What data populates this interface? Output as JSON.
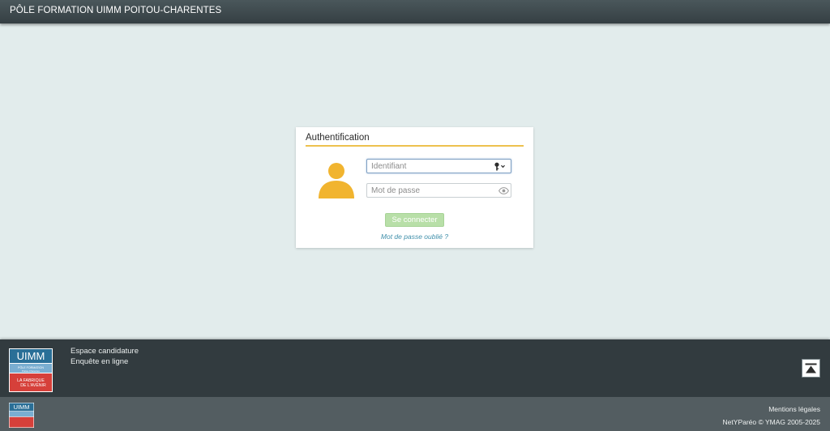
{
  "header": {
    "title": "PÔLE FORMATION UIMM POITOU-CHARENTES"
  },
  "login": {
    "title": "Authentification",
    "avatar_icon": "user-silhouette-icon",
    "identifier_placeholder": "Identifiant",
    "identifier_icon": "key-dropdown-icon",
    "password_placeholder": "Mot de passe",
    "password_icon": "eye-icon",
    "submit_label": "Se connecter",
    "forgot_label": "Mot de passe oublié ?"
  },
  "footer": {
    "logo": {
      "brand": "UIMM",
      "line1": "PÔLE FORMATION",
      "line2": "Poitou-Charentes",
      "tagline1": "LA FABRIQUE",
      "tagline2": "DE L'AVENIR"
    },
    "links": [
      "Espace candidature",
      "Enquête en ligne"
    ],
    "legal_label": "Mentions légales",
    "copyright": "NetYParéo © YMAG 2005-2025"
  },
  "colors": {
    "header_bg": "#3f4a4e",
    "page_bg": "#e2ecec",
    "accent_underline": "#edc14e",
    "avatar": "#f1b42f",
    "button_bg": "#b8dfa8",
    "link": "#3f8faa",
    "footer_top_bg": "#323b3f",
    "footer_bottom_bg": "#535d61"
  }
}
